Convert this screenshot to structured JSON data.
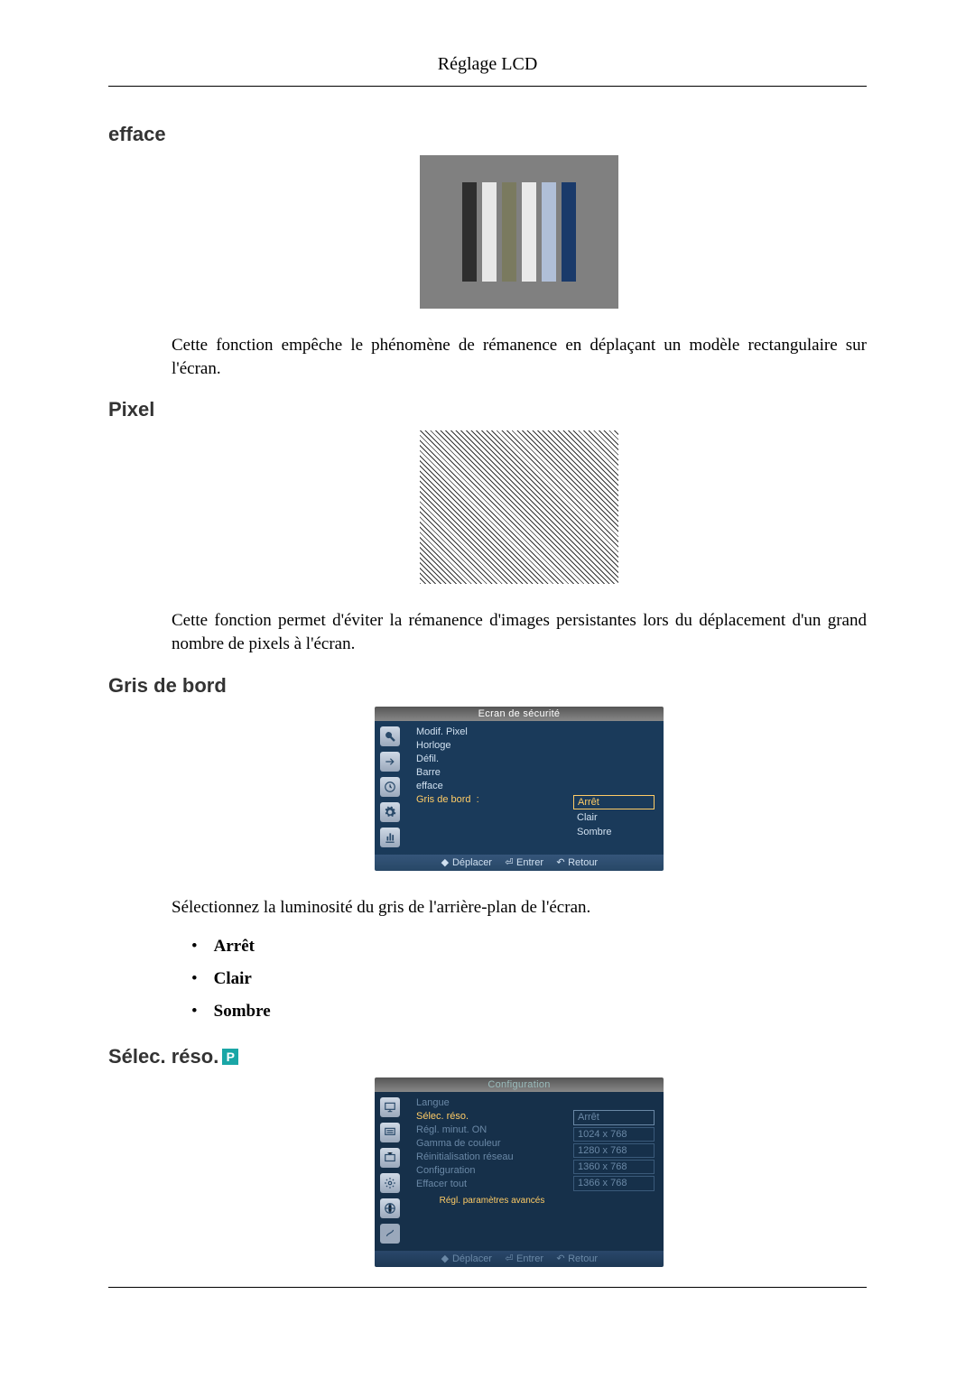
{
  "page_header": "Réglage LCD",
  "sections": {
    "efface": {
      "title": "efface",
      "description": "Cette fonction empêche le phénomène de rémanence en déplaçant un modèle rectangulaire sur l'écran.",
      "bars": [
        "#2e2e2e",
        "#e8e8e8",
        "#7a7a5f",
        "#eaeaea",
        "#b0bfd8",
        "#1a3a6a"
      ]
    },
    "pixel": {
      "title": "Pixel",
      "description": "Cette fonction permet d'éviter la rémanence d'images persistantes lors du déplacement d'un grand nombre de pixels à l'écran."
    },
    "gris_de_bord": {
      "title": "Gris de bord",
      "description": "Sélectionnez la luminosité du gris de l'arrière-plan de l'écran.",
      "options": [
        "Arrêt",
        "Clair",
        "Sombre"
      ],
      "menu": {
        "title": "Ecran de sécurité",
        "labels": [
          "Modif. Pixel",
          "Horloge",
          "Défil.",
          "Barre",
          "efface",
          "Gris de bord"
        ],
        "values": [
          "Arrêt",
          "Clair",
          "Sombre"
        ],
        "footer": {
          "move": "Déplacer",
          "enter": "Entrer",
          "return": "Retour"
        }
      }
    },
    "selec_reso": {
      "title": "Sélec. réso.",
      "badge": "P",
      "menu": {
        "title": "Configuration",
        "labels": [
          "Langue",
          "Sélec. réso.",
          "Régl. minut. ON",
          "Gamma de couleur",
          "Réinitialisation réseau",
          "Configuration",
          "Effacer tout"
        ],
        "values": [
          "Arrêt",
          "1024 x 768",
          "1280 x 768",
          "1360 x 768",
          "1366 x 768"
        ],
        "hint": "Régl. paramètres avancés",
        "footer": {
          "move": "Déplacer",
          "enter": "Entrer",
          "return": "Retour"
        }
      }
    }
  }
}
